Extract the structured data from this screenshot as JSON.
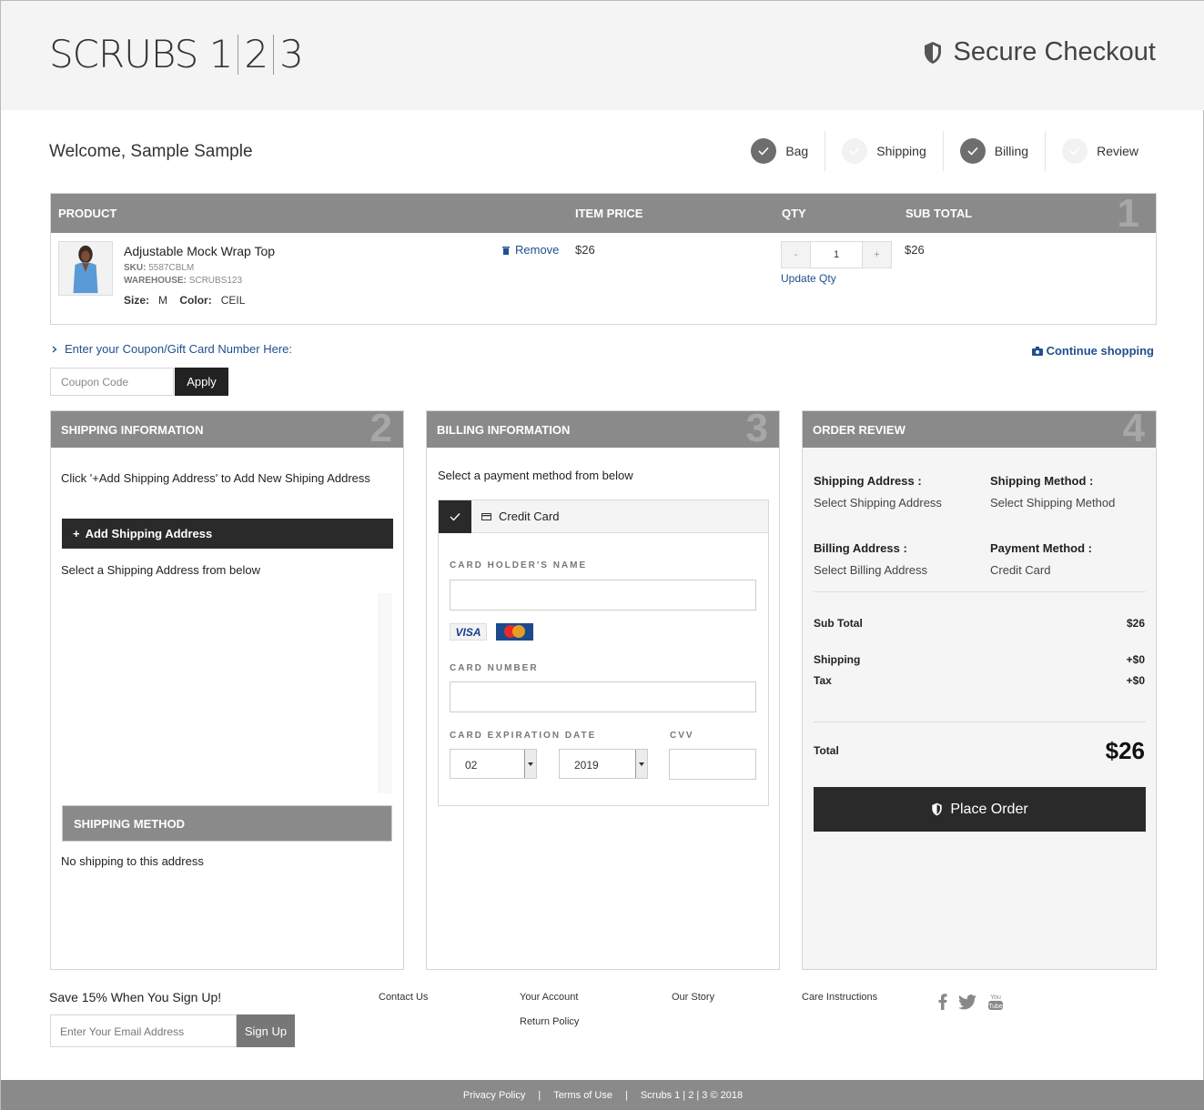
{
  "brand": {
    "logo_parts": [
      "SCRUBS 1",
      "2",
      "3"
    ]
  },
  "header": {
    "secure_label": "Secure Checkout"
  },
  "welcome": "Welcome, Sample Sample",
  "steps": [
    {
      "label": "Bag",
      "done": true
    },
    {
      "label": "Shipping",
      "done": false
    },
    {
      "label": "Billing",
      "done": true
    },
    {
      "label": "Review",
      "done": false
    }
  ],
  "cart": {
    "columns": {
      "product": "PRODUCT",
      "item_price": "ITEM PRICE",
      "qty": "QTY",
      "sub_total": "SUB TOTAL"
    },
    "section_number": "1",
    "item": {
      "name": "Adjustable Mock Wrap Top",
      "sku_label": "SKU:",
      "sku": "5587CBLM",
      "warehouse_label": "WAREHOUSE:",
      "warehouse": "SCRUBS123",
      "size_label": "Size:",
      "size": "M",
      "color_label": "Color:",
      "color": "CEIL",
      "remove_label": "Remove",
      "price": "$26",
      "qty_minus": "-",
      "qty": "1",
      "qty_plus": "+",
      "update_qty_label": "Update Qty",
      "subtotal": "$26"
    }
  },
  "coupon": {
    "link_label": "Enter your Coupon/Gift Card Number Here:",
    "placeholder": "Coupon Code",
    "apply_label": "Apply",
    "continue_label": "Continue shopping"
  },
  "shipping": {
    "title": "SHIPPING INFORMATION",
    "section_number": "2",
    "note": "Click '+Add Shipping Address' to Add New Shiping Address",
    "add_label": "Add Shipping Address",
    "select_label": "Select a Shipping Address from below",
    "method_title": "SHIPPING METHOD",
    "no_shipping": "No shipping to this address"
  },
  "billing": {
    "title": "BILLING INFORMATION",
    "section_number": "3",
    "note": "Select a payment method from below",
    "method_label": "Credit Card",
    "holder_label": "CARD HOLDER'S NAME",
    "card_brands": [
      "VISA",
      "MasterCard"
    ],
    "number_label": "CARD NUMBER",
    "expiry_label": "CARD EXPIRATION DATE",
    "cvv_label": "CVV",
    "exp_month": "02",
    "exp_year": "2019"
  },
  "review": {
    "title": "ORDER REVIEW",
    "section_number": "4",
    "shipping_address_label": "Shipping Address :",
    "shipping_address_value": "Select Shipping Address",
    "shipping_method_label": "Shipping Method :",
    "shipping_method_value": "Select Shipping Method",
    "billing_address_label": "Billing Address :",
    "billing_address_value": "Select Billing Address",
    "payment_method_label": "Payment Method :",
    "payment_method_value": "Credit Card",
    "subtotal_label": "Sub Total",
    "subtotal_value": "$26",
    "shipping_label": "Shipping",
    "shipping_value": "+$0",
    "tax_label": "Tax",
    "tax_value": "+$0",
    "total_label": "Total",
    "total_value": "$26",
    "place_order_label": "Place Order"
  },
  "footer": {
    "signup_title": "Save 15% When You Sign Up!",
    "email_placeholder": "Enter Your Email Address",
    "signup_label": "Sign Up",
    "links": {
      "contact": "Contact Us",
      "account": "Your Account",
      "return": "Return Policy",
      "story": "Our Story",
      "care": "Care Instructions"
    },
    "social": [
      "facebook-icon",
      "twitter-icon",
      "youtube-icon"
    ],
    "bottom": {
      "privacy": "Privacy Policy",
      "terms": "Terms of Use",
      "copyright": "Scrubs 1 | 2 | 3 © 2018",
      "separator": "|"
    }
  }
}
